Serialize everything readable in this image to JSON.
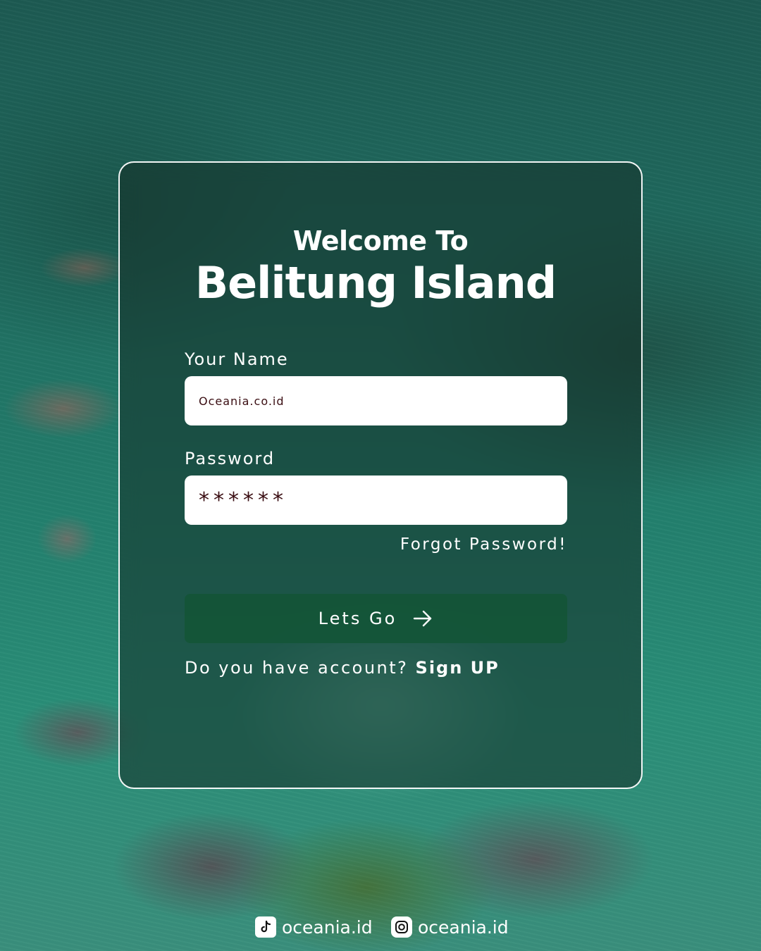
{
  "header": {
    "welcome": "Welcome To",
    "place": "Belitung Island"
  },
  "form": {
    "name_label": "Your Name",
    "name_value": "Oceania.co.id",
    "password_label": "Password",
    "password_value": "******",
    "forgot_label": "Forgot Password!",
    "submit_label": "Lets Go",
    "signup_prompt": "Do you have account?",
    "signup_link": "Sign UP"
  },
  "footer": {
    "tiktok_handle": "oceania.id",
    "instagram_handle": "oceania.id"
  },
  "colors": {
    "button_bg": "#155537",
    "input_text": "#3a0d12",
    "card_border": "#ffffff"
  },
  "icons": [
    "arrow-right-icon",
    "tiktok-icon",
    "instagram-icon"
  ]
}
